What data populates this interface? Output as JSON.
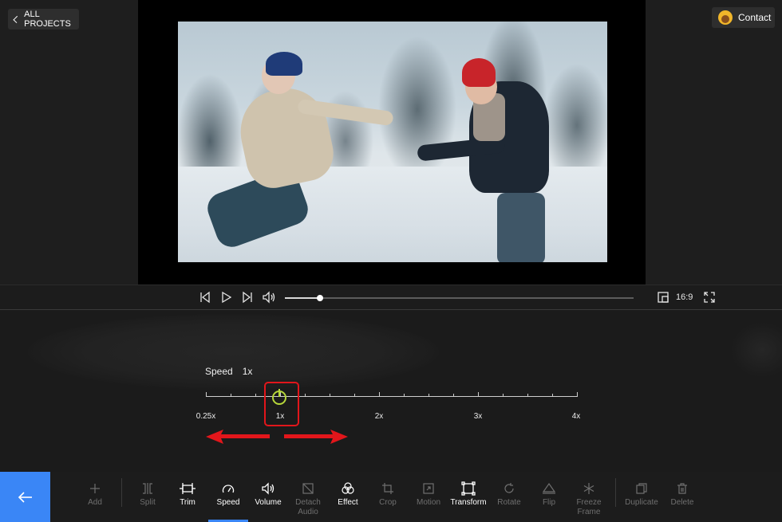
{
  "header": {
    "back_projects_label": "ALL PROJECTS",
    "contact_label": "Contact"
  },
  "player": {
    "progress_fraction": 0.1,
    "aspect_ratio_label": "16:9"
  },
  "speed_panel": {
    "title": "Speed",
    "current_value": "1x",
    "scale_labels": [
      "0.25x",
      "1x",
      "2x",
      "3x",
      "4x"
    ],
    "scale_min": 0.25,
    "scale_max": 4
  },
  "toolbar": {
    "items": [
      {
        "label": "Add",
        "icon": "plus-icon",
        "enabled": false
      },
      {
        "label": "Split",
        "icon": "split-icon",
        "enabled": false
      },
      {
        "label": "Trim",
        "icon": "trim-icon",
        "enabled": true
      },
      {
        "label": "Speed",
        "icon": "speed-icon",
        "enabled": true,
        "active": true
      },
      {
        "label": "Volume",
        "icon": "volume-icon",
        "enabled": true
      },
      {
        "label": "Detach Audio",
        "icon": "detach-audio-icon",
        "enabled": false
      },
      {
        "label": "Effect",
        "icon": "effect-icon",
        "enabled": true
      },
      {
        "label": "Crop",
        "icon": "crop-icon",
        "enabled": false
      },
      {
        "label": "Motion",
        "icon": "motion-icon",
        "enabled": false
      },
      {
        "label": "Transform",
        "icon": "transform-icon",
        "enabled": true
      },
      {
        "label": "Rotate",
        "icon": "rotate-icon",
        "enabled": false
      },
      {
        "label": "Flip",
        "icon": "flip-icon",
        "enabled": false
      },
      {
        "label": "Freeze Frame",
        "icon": "snowflake-icon",
        "enabled": false
      },
      {
        "label": "Duplicate",
        "icon": "duplicate-icon",
        "enabled": false
      },
      {
        "label": "Delete",
        "icon": "trash-icon",
        "enabled": false
      }
    ]
  },
  "colors": {
    "accent_blue": "#3a86f6",
    "knob_green": "#b6d63a",
    "highlight_red": "#e2161b"
  }
}
